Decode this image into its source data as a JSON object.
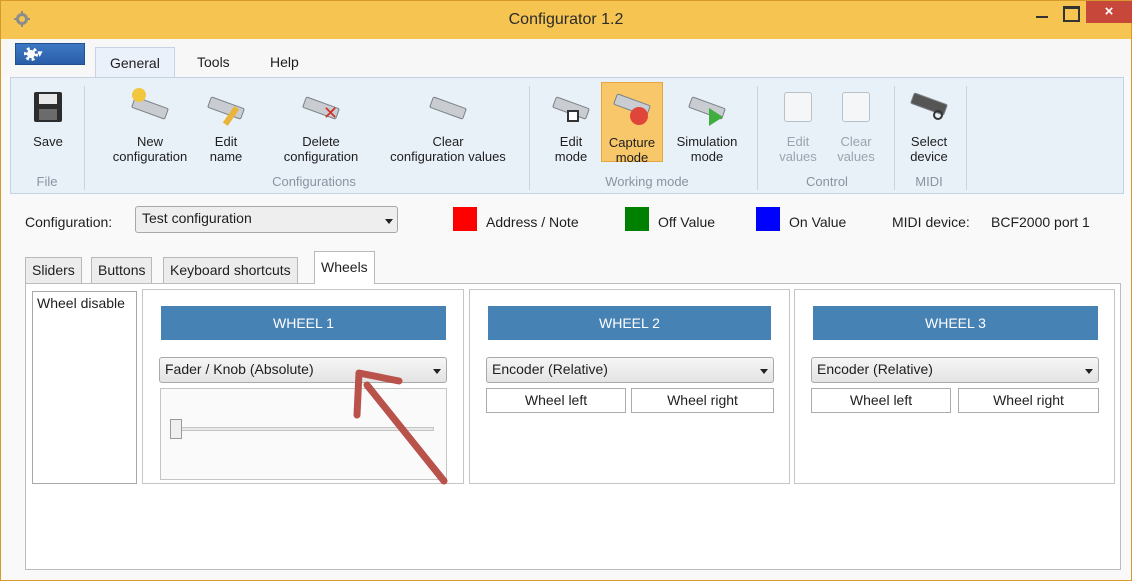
{
  "window": {
    "title": "Configurator 1.2",
    "close_glyph": "×"
  },
  "ribbon_tabs": [
    "General",
    "Tools",
    "Help"
  ],
  "ribbon": {
    "save": "Save",
    "new_configuration": "New\nconfiguration",
    "edit_name": "Edit\nname",
    "delete_configuration": "Delete\nconfiguration",
    "clear_configuration_values": "Clear\nconfiguration values",
    "edit_mode": "Edit\nmode",
    "capture_mode": "Capture\nmode",
    "simulation_mode": "Simulation\nmode",
    "edit_values": "Edit\nvalues",
    "clear_values": "Clear\nvalues",
    "select_device": "Select\ndevice",
    "groups": {
      "file": "File",
      "configurations": "Configurations",
      "working_mode": "Working mode",
      "control": "Control",
      "midi": "MIDI"
    }
  },
  "config_bar": {
    "label": "Configuration:",
    "selected": "Test configuration",
    "legend": [
      {
        "label": "Address / Note",
        "color": "#ff0000"
      },
      {
        "label": "Off Value",
        "color": "#008000"
      },
      {
        "label": "On Value",
        "color": "#0000ff"
      }
    ],
    "midi_device_label": "MIDI device:",
    "midi_device_value": "BCF2000 port 1"
  },
  "content_tabs": [
    "Sliders",
    "Buttons",
    "Keyboard shortcuts",
    "Wheels"
  ],
  "wheel_list": [
    "Wheel disable"
  ],
  "wheels": [
    {
      "header": "WHEEL 1",
      "mode": "Fader / Knob (Absolute)",
      "slider_value": 0
    },
    {
      "header": "WHEEL 2",
      "mode": "Encoder (Relative)",
      "left": "Wheel left",
      "right": "Wheel right"
    },
    {
      "header": "WHEEL 3",
      "mode": "Encoder (Relative)",
      "left": "Wheel left",
      "right": "Wheel right"
    }
  ],
  "colors": {
    "title_bar": "#f5c451",
    "accent_header": "#4782b5",
    "close_button": "#c7483b",
    "annotation_arrow": "#b8524a"
  }
}
